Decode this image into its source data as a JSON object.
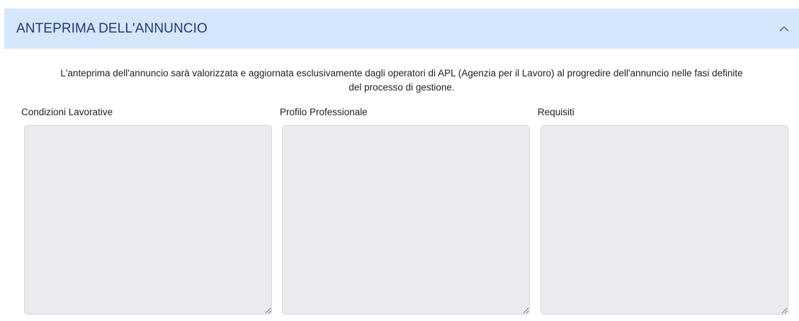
{
  "section": {
    "title": "ANTEPRIMA DELL'ANNUNCIO",
    "collapse_icon": "chevron-up-icon"
  },
  "notice": {
    "line1": "L'anteprima dell'annuncio sarà valorizzata e aggiornata esclusivamente dagli operatori di APL (Agenzia per il Lavoro) al progredire dell'annuncio nelle fasi definite",
    "line2": "del processo di gestione."
  },
  "fields": [
    {
      "label": "Condizioni Lavorative",
      "value": ""
    },
    {
      "label": "Profilo Professionale",
      "value": ""
    },
    {
      "label": "Requisiti",
      "value": ""
    }
  ],
  "colors": {
    "header_bg": "#d6e6fb",
    "header_text": "#1d3b6e",
    "field_bg": "#e9ebee"
  }
}
